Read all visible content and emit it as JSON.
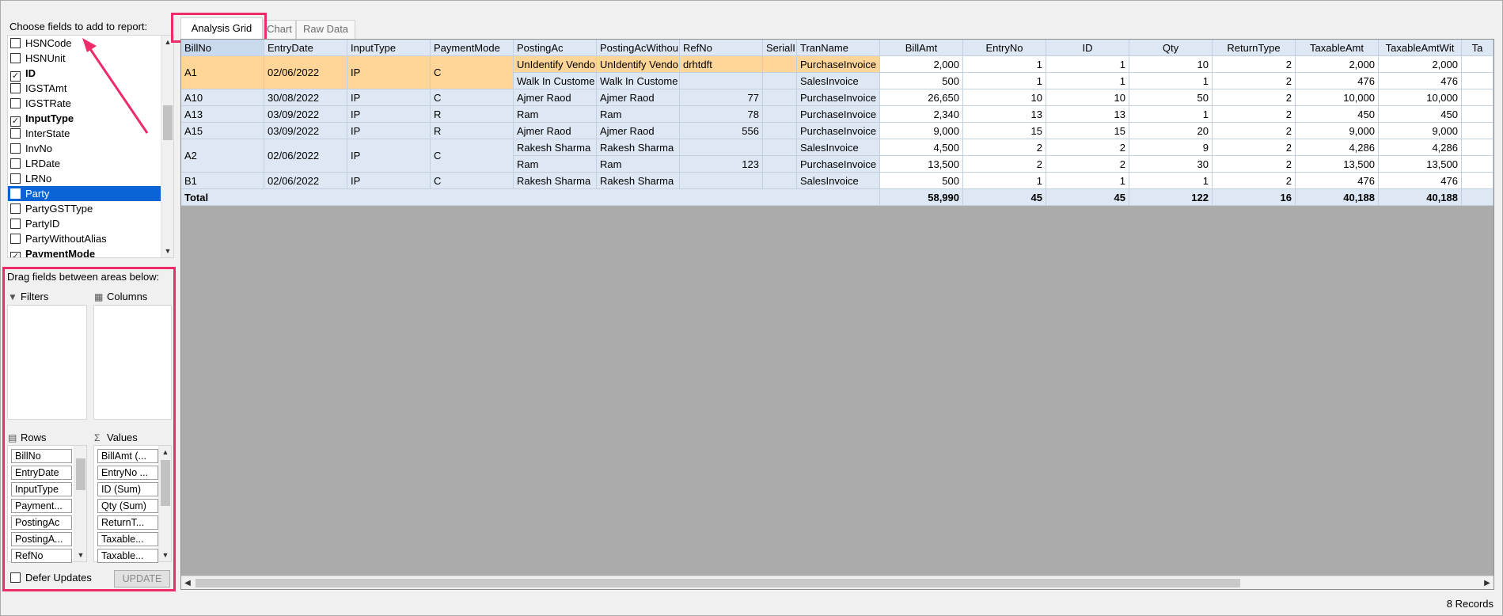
{
  "field_chooser": {
    "title": "Choose fields to add to report:",
    "fields": [
      {
        "label": "HSNCode",
        "checked": false,
        "bold": false,
        "selected": false
      },
      {
        "label": "HSNUnit",
        "checked": false,
        "bold": false,
        "selected": false
      },
      {
        "label": "ID",
        "checked": true,
        "bold": true,
        "selected": false
      },
      {
        "label": "IGSTAmt",
        "checked": false,
        "bold": false,
        "selected": false
      },
      {
        "label": "IGSTRate",
        "checked": false,
        "bold": false,
        "selected": false
      },
      {
        "label": "InputType",
        "checked": true,
        "bold": true,
        "selected": false
      },
      {
        "label": "InterState",
        "checked": false,
        "bold": false,
        "selected": false
      },
      {
        "label": "InvNo",
        "checked": false,
        "bold": false,
        "selected": false
      },
      {
        "label": "LRDate",
        "checked": false,
        "bold": false,
        "selected": false
      },
      {
        "label": "LRNo",
        "checked": false,
        "bold": false,
        "selected": false
      },
      {
        "label": "Party",
        "checked": false,
        "bold": false,
        "selected": true
      },
      {
        "label": "PartyGSTType",
        "checked": false,
        "bold": false,
        "selected": false
      },
      {
        "label": "PartyID",
        "checked": false,
        "bold": false,
        "selected": false
      },
      {
        "label": "PartyWithoutAlias",
        "checked": false,
        "bold": false,
        "selected": false
      },
      {
        "label": "PaymentMode",
        "checked": true,
        "bold": true,
        "selected": false
      }
    ]
  },
  "areas": {
    "title": "Drag fields between areas below:",
    "filters_label": "Filters",
    "columns_label": "Columns",
    "rows_label": "Rows",
    "values_label": "Values",
    "rows": [
      "BillNo",
      "EntryDate",
      "InputType",
      "Payment...",
      "PostingAc",
      "PostingA...",
      "RefNo"
    ],
    "values": [
      "BillAmt (...",
      "EntryNo ...",
      "ID (Sum)",
      "Qty (Sum)",
      "ReturnT...",
      "Taxable...",
      "Taxable..."
    ],
    "defer_label": "Defer Updates",
    "update_label": "UPDATE"
  },
  "tabs": [
    {
      "label": "Analysis Grid",
      "active": true
    },
    {
      "label": "Chart",
      "active": false
    },
    {
      "label": "Raw Data",
      "active": false
    }
  ],
  "grid": {
    "row_headers": [
      "BillNo",
      "EntryDate",
      "InputType",
      "PaymentMode",
      "PostingAc",
      "PostingAcWithou",
      "RefNo",
      "SerialI",
      "TranName"
    ],
    "value_headers": [
      "BillAmt",
      "EntryNo",
      "ID",
      "Qty",
      "ReturnType",
      "TaxableAmt",
      "TaxableAmtWit",
      "Ta"
    ],
    "groups": [
      {
        "billno": "A1",
        "date": "02/06/2022",
        "input": "IP",
        "pay": "C",
        "selected": true,
        "rows": [
          {
            "posting": "UnIdentify Vendo",
            "postingwo": "UnIdentify Vendo",
            "refno": "drhtdft",
            "serial": "",
            "tran": "PurchaseInvoice",
            "vals": [
              "2,000",
              "1",
              "1",
              "10",
              "2",
              "2,000",
              "2,000",
              ""
            ]
          },
          {
            "posting": "Walk In Custome",
            "postingwo": "Walk In Custome",
            "refno": "",
            "serial": "",
            "tran": "SalesInvoice",
            "vals": [
              "500",
              "1",
              "1",
              "1",
              "2",
              "476",
              "476",
              ""
            ]
          }
        ]
      },
      {
        "billno": "A10",
        "date": "30/08/2022",
        "input": "IP",
        "pay": "C",
        "selected": false,
        "rows": [
          {
            "posting": "Ajmer Raod",
            "postingwo": "Ajmer Raod",
            "refno": "77",
            "serial": "",
            "tran": "PurchaseInvoice",
            "vals": [
              "26,650",
              "10",
              "10",
              "50",
              "2",
              "10,000",
              "10,000",
              ""
            ]
          }
        ]
      },
      {
        "billno": "A13",
        "date": "03/09/2022",
        "input": "IP",
        "pay": "R",
        "selected": false,
        "rows": [
          {
            "posting": "Ram",
            "postingwo": "Ram",
            "refno": "78",
            "serial": "",
            "tran": "PurchaseInvoice",
            "vals": [
              "2,340",
              "13",
              "13",
              "1",
              "2",
              "450",
              "450",
              ""
            ]
          }
        ]
      },
      {
        "billno": "A15",
        "date": "03/09/2022",
        "input": "IP",
        "pay": "R",
        "selected": false,
        "rows": [
          {
            "posting": "Ajmer Raod",
            "postingwo": "Ajmer Raod",
            "refno": "556",
            "serial": "",
            "tran": "PurchaseInvoice",
            "vals": [
              "9,000",
              "15",
              "15",
              "20",
              "2",
              "9,000",
              "9,000",
              ""
            ]
          }
        ]
      },
      {
        "billno": "A2",
        "date": "02/06/2022",
        "input": "IP",
        "pay": "C",
        "selected": false,
        "rows": [
          {
            "posting": "Rakesh Sharma",
            "postingwo": "Rakesh Sharma",
            "refno": "",
            "serial": "",
            "tran": "SalesInvoice",
            "vals": [
              "4,500",
              "2",
              "2",
              "9",
              "2",
              "4,286",
              "4,286",
              ""
            ]
          },
          {
            "posting": "Ram",
            "postingwo": "Ram",
            "refno": "123",
            "serial": "",
            "tran": "PurchaseInvoice",
            "vals": [
              "13,500",
              "2",
              "2",
              "30",
              "2",
              "13,500",
              "13,500",
              ""
            ]
          }
        ]
      },
      {
        "billno": "B1",
        "date": "02/06/2022",
        "input": "IP",
        "pay": "C",
        "selected": false,
        "rows": [
          {
            "posting": "Rakesh Sharma",
            "postingwo": "Rakesh Sharma",
            "refno": "",
            "serial": "",
            "tran": "SalesInvoice",
            "vals": [
              "500",
              "1",
              "1",
              "1",
              "2",
              "476",
              "476",
              ""
            ]
          }
        ]
      }
    ],
    "total_label": "Total",
    "totals": [
      "58,990",
      "45",
      "45",
      "122",
      "16",
      "40,188",
      "40,188",
      ""
    ]
  },
  "status": {
    "records": "8 Records"
  },
  "colors": {
    "highlight_box": "#ec2d6a",
    "selected_row": "#ffd697",
    "header_bg": "#dde8f4",
    "list_selection": "#0a64d6"
  }
}
